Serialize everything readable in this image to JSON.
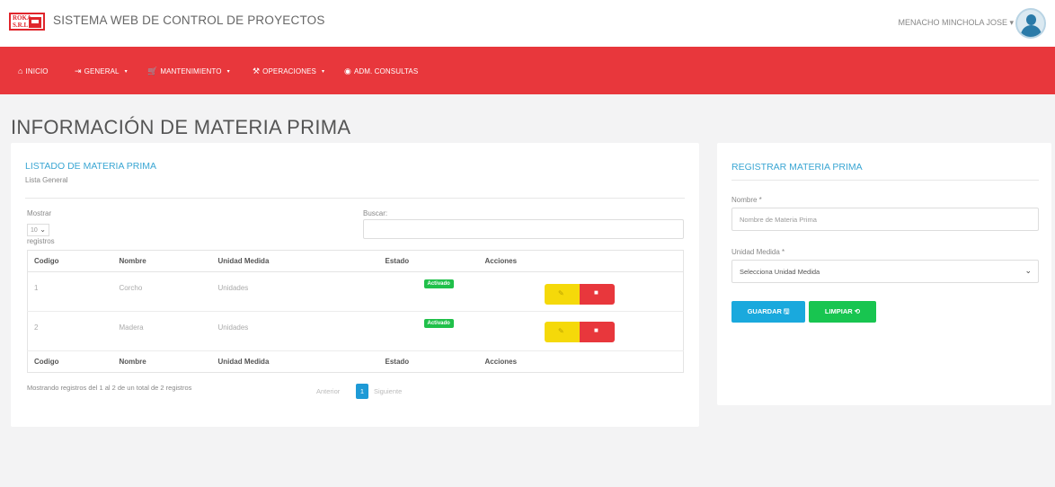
{
  "header": {
    "logo_line1": "ROKA",
    "logo_line2": "S.R.L",
    "title": "SISTEMA WEB DE CONTROL DE PROYECTOS",
    "user": "MENACHO MINCHOLA JOSE ▾",
    "avatar_icon": "user-avatar-icon"
  },
  "nav": [
    {
      "label": "INICIO",
      "icon": "home-icon",
      "glyph": "⌂"
    },
    {
      "label": "GENERAL",
      "icon": "sign-in-icon",
      "glyph": "⇥",
      "caret": "▾"
    },
    {
      "label": "MANTENIMIENTO",
      "icon": "cart-icon",
      "glyph": "🛒",
      "caret": "▾"
    },
    {
      "label": "OPERACIONES",
      "icon": "tools-icon",
      "glyph": "⚒",
      "caret": "▾"
    },
    {
      "label": "ADM. CONSULTAS",
      "icon": "eye-icon",
      "glyph": "◉"
    }
  ],
  "page_title": "INFORMACIÓN DE MATERIA PRIMA",
  "list": {
    "title": "LISTADO DE MATERIA PRIMA",
    "subtitle": "Lista General",
    "show_label": "Mostrar",
    "show_value": "10",
    "records_label": "registros",
    "search_label": "Buscar:",
    "columns": [
      "Codigo",
      "Nombre",
      "Unidad Medida",
      "Estado",
      "Acciones"
    ],
    "rows": [
      {
        "codigo": "1",
        "nombre": "Corcho",
        "unidad": "Unidades",
        "estado": "Activado"
      },
      {
        "codigo": "2",
        "nombre": "Madera",
        "unidad": "Unidades",
        "estado": "Activado"
      }
    ],
    "info": "Mostrando registros del 1 al 2 de un total de 2 registros",
    "prev": "Anterior",
    "page": "1",
    "next": "Siguiente",
    "colors": {
      "accent": "#3aa6d3",
      "badge": "#20c04a",
      "edit": "#f5d90a",
      "delete": "#e8373c"
    }
  },
  "form": {
    "title": "REGISTRAR MATERIA PRIMA",
    "nombre_label": "Nombre *",
    "nombre_placeholder": "Nombre de Materia Prima",
    "unidad_label": "Unidad Medida *",
    "unidad_value": "Selecciona Unidad Medida",
    "save_label": "GUARDAR 🖫",
    "clear_label": "LIMPIAR ⟲"
  },
  "theme": {
    "navbar": "#e8373c",
    "save": "#1aa9dd",
    "clear": "#18c550"
  }
}
